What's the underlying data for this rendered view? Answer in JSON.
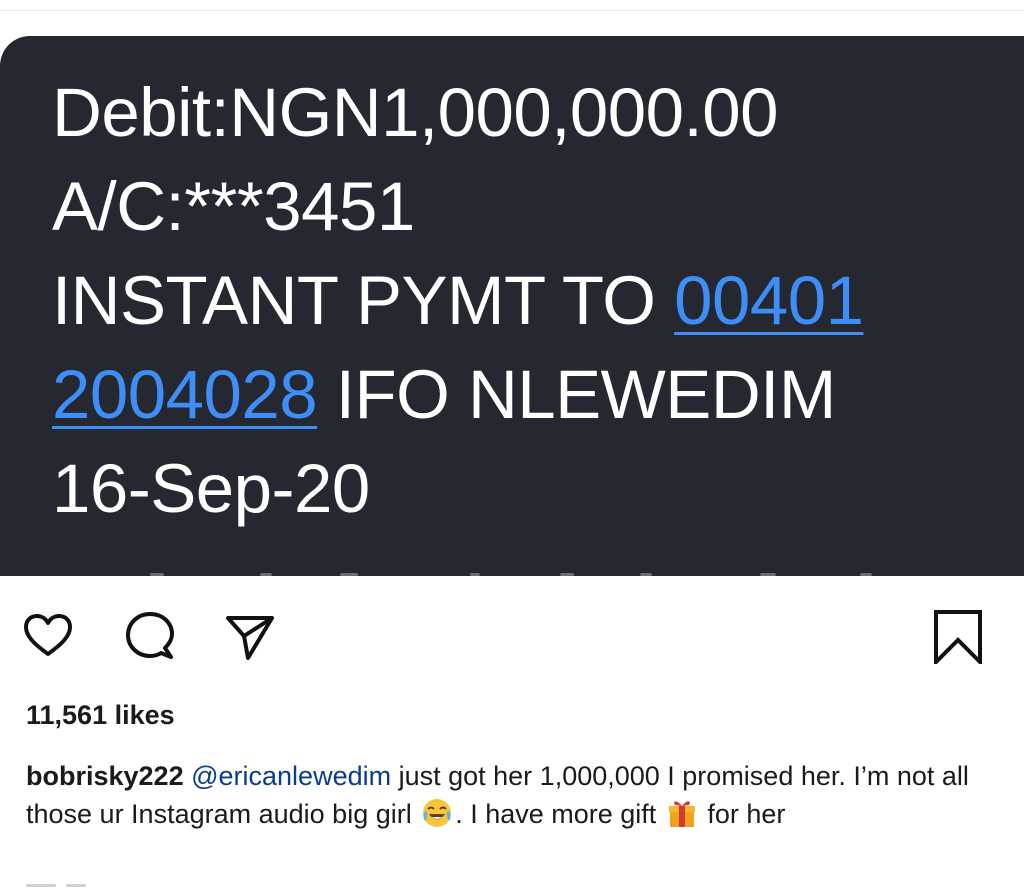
{
  "sms": {
    "line1": "Debit:NGN1,000,000.00",
    "line2": "A/C:***3451",
    "line3_text": "INSTANT PYMT TO ",
    "line3_link": "00401",
    "line4_link": "2004028",
    "line4_text": " IFO NLEWEDIM",
    "line5": "16-Sep-20"
  },
  "actions": {
    "like_icon": "heart-icon",
    "comment_icon": "comment-icon",
    "share_icon": "paper-plane-icon",
    "save_icon": "bookmark-icon"
  },
  "post": {
    "likes": "11,561 likes",
    "username": "bobrisky222",
    "mention": "@ericanlewedim",
    "caption_part1": " just got her 1,000,000 I promised her. I’m not all those ur Instagram audio big girl ",
    "emoji_1": "face-with-tears-of-joy",
    "caption_part2": ". I have more gift ",
    "emoji_2": "wrapped-gift",
    "caption_part3": " for her"
  },
  "colors": {
    "sms_background": "#252830",
    "link": "#3e8ef7",
    "mention": "#0a3d8f"
  }
}
